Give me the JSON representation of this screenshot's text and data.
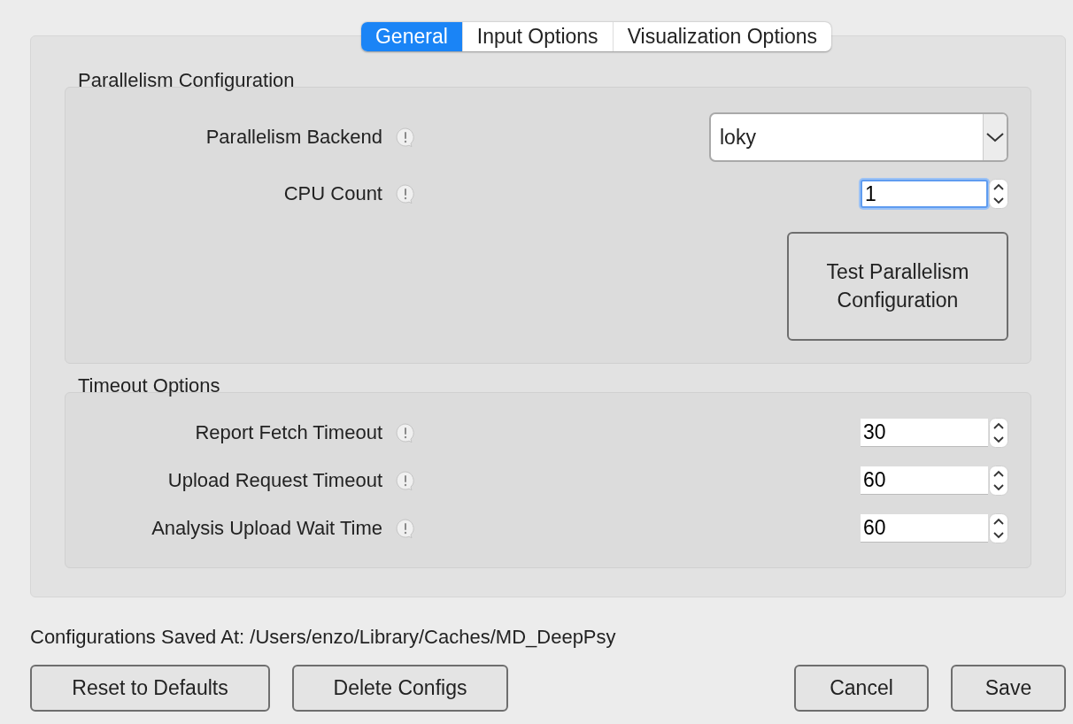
{
  "tabs": [
    {
      "label": "General",
      "selected": true
    },
    {
      "label": "Input Options",
      "selected": false
    },
    {
      "label": "Visualization Options",
      "selected": false
    }
  ],
  "groups": [
    {
      "title": "Parallelism Configuration",
      "fields": [
        {
          "label": "Parallelism Backend",
          "kind": "select",
          "value": "loky"
        },
        {
          "label": "CPU Count",
          "kind": "spin",
          "value": "1",
          "focused": true
        }
      ],
      "action": "Test Parallelism Configuration"
    },
    {
      "title": "Timeout Options",
      "fields": [
        {
          "label": "Report Fetch Timeout",
          "kind": "spin",
          "value": "30",
          "focused": false
        },
        {
          "label": "Upload Request Timeout",
          "kind": "spin",
          "value": "60",
          "focused": false
        },
        {
          "label": "Analysis Upload Wait Time",
          "kind": "spin",
          "value": "60",
          "focused": false
        }
      ]
    }
  ],
  "saved_path": "Configurations Saved At: /Users/enzo/Library/Caches/MD_DeepPsy",
  "buttons_left": [
    "Reset to Defaults",
    "Delete Configs"
  ],
  "buttons_right": [
    "Cancel",
    "Save"
  ]
}
